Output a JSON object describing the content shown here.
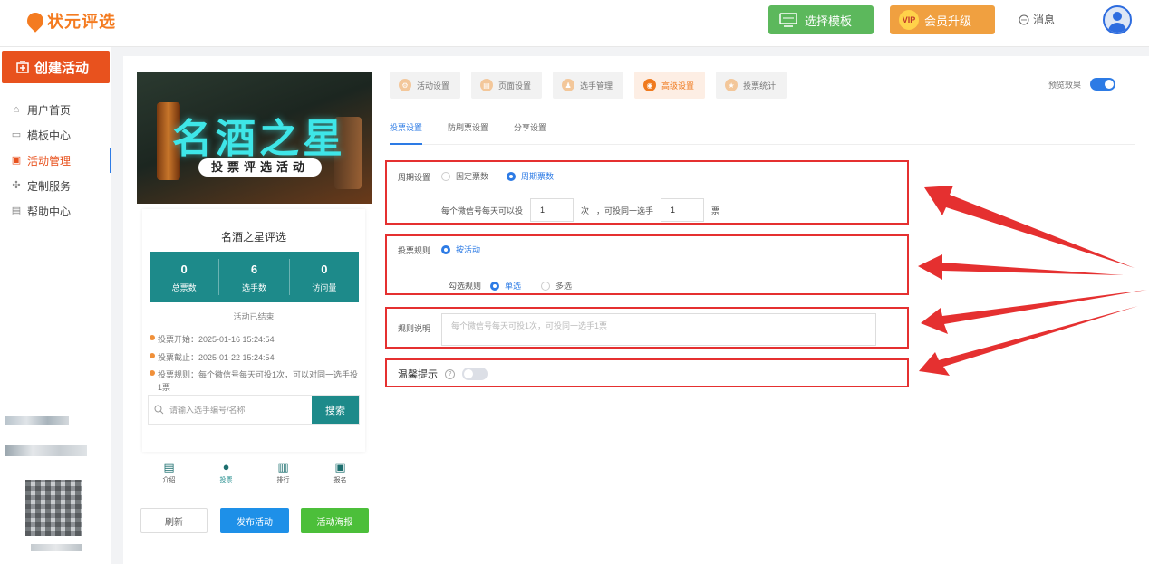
{
  "header": {
    "logo_text": "状元评选",
    "template_btn": "选择模板",
    "vip_badge": "VIP",
    "vip_btn": "会员升级",
    "message": "消息"
  },
  "sidebar": {
    "create_btn": "创建活动",
    "items": [
      {
        "label": "用户首页",
        "icon": "home-icon"
      },
      {
        "label": "模板中心",
        "icon": "template-icon"
      },
      {
        "label": "活动管理",
        "icon": "ticket-icon",
        "active": true
      },
      {
        "label": "定制服务",
        "icon": "custom-icon"
      },
      {
        "label": "帮助中心",
        "icon": "help-icon"
      }
    ]
  },
  "phone": {
    "poster_title": "名酒之星",
    "poster_subtitle": "投票评选活动",
    "activity_name": "名酒之星评选",
    "stats": [
      {
        "value": "0",
        "label": "总票数"
      },
      {
        "value": "6",
        "label": "选手数"
      },
      {
        "value": "0",
        "label": "访问量"
      }
    ],
    "status": "活动已结束",
    "vote_start": "投票开始：2025-01-16 15:24:54",
    "vote_end": "投票截止：2025-01-22 15:24:54",
    "vote_rule": "投票规则：每个微信号每天可投1次，可以对同一选手投1票",
    "search_placeholder": "请输入选手编号/名称",
    "search_btn": "搜索",
    "tabs": [
      {
        "label": "介绍",
        "icon": "intro-icon"
      },
      {
        "label": "投票",
        "icon": "vote-icon",
        "active": true
      },
      {
        "label": "排行",
        "icon": "rank-icon"
      },
      {
        "label": "报名",
        "icon": "signup-icon"
      }
    ],
    "refresh_btn": "刷新",
    "publish_btn": "发布活动",
    "poster_btn": "活动海报"
  },
  "tabs": [
    {
      "label": "活动设置"
    },
    {
      "label": "页面设置"
    },
    {
      "label": "选手管理"
    },
    {
      "label": "高级设置",
      "active": true
    },
    {
      "label": "投票统计"
    }
  ],
  "preview_label": "预览效果",
  "subtabs": [
    {
      "label": "投票设置",
      "active": true
    },
    {
      "label": "防刷票设置"
    },
    {
      "label": "分享设置"
    }
  ],
  "period": {
    "label": "周期设置",
    "option_fixed": "固定票数",
    "option_cycle": "周期票数",
    "text_prefix": "每个微信号每天可以投",
    "times_value": "1",
    "text_times": "次",
    "text_middle": "，可投同一选手",
    "votes_value": "1",
    "text_votes": "票"
  },
  "rule": {
    "label": "投票规则",
    "option": "按活动",
    "check_label": "勾选规则",
    "single": "单选",
    "multi": "多选"
  },
  "description": {
    "label": "规则说明",
    "placeholder": "每个微信号每天可投1次，可投同一选手1票"
  },
  "tip": {
    "label": "温馨提示",
    "help_icon": "?"
  },
  "colors": {
    "accent_orange": "#f47b20",
    "accent_blue": "#2d7be5",
    "teal": "#1d8a8a",
    "highlight_red": "#e53030"
  }
}
